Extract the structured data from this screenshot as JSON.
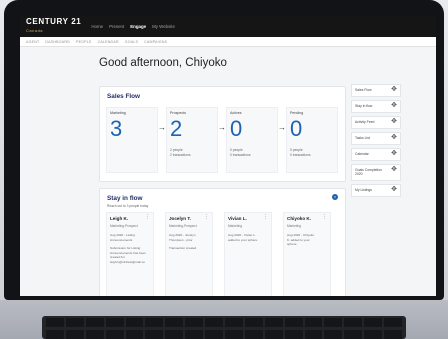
{
  "brand": {
    "name": "CENTURY 21",
    "sub": "Canada"
  },
  "nav": {
    "items": [
      "Home",
      "Present",
      "Engage",
      "My Website"
    ],
    "active_index": 2
  },
  "subnav": {
    "items": [
      "AGENT",
      "DASHBOARD",
      "PEOPLE",
      "CALENDAR",
      "GOALS",
      "CAMPAIGNS"
    ]
  },
  "greeting": "Good afternoon, Chiyoko",
  "sales_flow": {
    "title": "Sales Flow",
    "stats": [
      {
        "label": "Marketing",
        "value": "3",
        "detail1": "",
        "detail2": ""
      },
      {
        "label": "Prospects",
        "value": "2",
        "detail1": "2 people",
        "detail2": "2 transactions"
      },
      {
        "label": "Actives",
        "value": "0",
        "detail1": "0 people",
        "detail2": "0 transactions"
      },
      {
        "label": "Pending",
        "value": "0",
        "detail1": "0 people",
        "detail2": "0 transactions"
      }
    ]
  },
  "side_panel": {
    "items": [
      "Sales Flow",
      "Stay in flow",
      "Activity Feed",
      "Tasks List",
      "Calendar",
      "Goals Completion 2020",
      "My Listings"
    ]
  },
  "stay_in_flow": {
    "title": "Stay in flow",
    "subtitle": "Reach out to 3 people today",
    "people": [
      {
        "name": "Leigh K.",
        "role": "Marketing-Prospect",
        "lines": [
          "Aug 2020 - Listing",
          "Announcements",
          "",
          "Submission for Listing",
          "Announcements has been",
          "created for",
          "leigh.k@c21test@mail.co"
        ]
      },
      {
        "name": "Jocelyn T.",
        "role": "Marketing-Prospect",
        "lines": [
          "Aug 2020 - Jocelyn",
          "Thompson - prior",
          "",
          "Transaction created"
        ]
      },
      {
        "name": "Vivian L.",
        "role": "Marketing",
        "lines": [
          "Aug 2020 - Vivian L.",
          "added to your sphere."
        ]
      },
      {
        "name": "Chiyoko K.",
        "role": "Marketing",
        "lines": [
          "Aug 2020 - Chiyoko",
          "K. added to your",
          "sphere."
        ]
      }
    ]
  }
}
